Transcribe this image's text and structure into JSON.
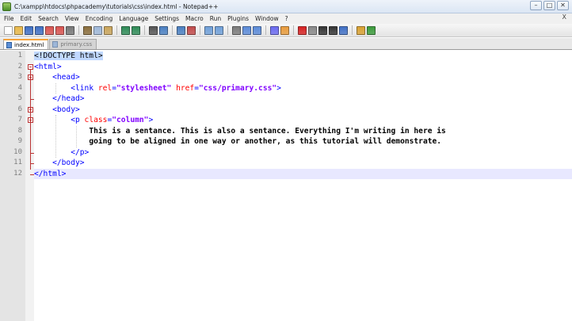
{
  "window": {
    "title": "C:\\xampp\\htdocs\\phpacademy\\tutorials\\css\\index.html - Notepad++",
    "controls": [
      "–",
      "□",
      "✕"
    ]
  },
  "menu": {
    "items": [
      "File",
      "Edit",
      "Search",
      "View",
      "Encoding",
      "Language",
      "Settings",
      "Macro",
      "Run",
      "Plugins",
      "Window",
      "?"
    ],
    "close": "X"
  },
  "tabs": [
    {
      "label": "index.html",
      "active": true
    },
    {
      "label": "primary.css",
      "active": false
    }
  ],
  "editor": {
    "line_numbers": [
      "1",
      "2",
      "3",
      "4",
      "5",
      "6",
      "7",
      "8",
      "9",
      "10",
      "11",
      "12"
    ],
    "current_line": 12,
    "lines": [
      [
        {
          "t": "doctype",
          "v": "<!DOCTYPE html>"
        }
      ],
      [
        {
          "t": "tag",
          "v": "<html>"
        }
      ],
      [
        {
          "t": "plain",
          "v": "    "
        },
        {
          "t": "tag",
          "v": "<head>"
        }
      ],
      [
        {
          "t": "plain",
          "v": "        "
        },
        {
          "t": "tag",
          "v": "<link "
        },
        {
          "t": "attr",
          "v": "rel"
        },
        {
          "t": "tag",
          "v": "="
        },
        {
          "t": "val",
          "v": "\"stylesheet\""
        },
        {
          "t": "plain",
          "v": " "
        },
        {
          "t": "attr",
          "v": "href"
        },
        {
          "t": "tag",
          "v": "="
        },
        {
          "t": "val",
          "v": "\"css/primary.css\""
        },
        {
          "t": "tag",
          "v": ">"
        }
      ],
      [
        {
          "t": "plain",
          "v": "    "
        },
        {
          "t": "tag",
          "v": "</head>"
        }
      ],
      [
        {
          "t": "plain",
          "v": "    "
        },
        {
          "t": "tag",
          "v": "<body>"
        }
      ],
      [
        {
          "t": "plain",
          "v": "        "
        },
        {
          "t": "tag",
          "v": "<p "
        },
        {
          "t": "attr",
          "v": "class"
        },
        {
          "t": "tag",
          "v": "="
        },
        {
          "t": "val",
          "v": "\"column\""
        },
        {
          "t": "tag",
          "v": ">"
        }
      ],
      [
        {
          "t": "plain",
          "v": "            "
        },
        {
          "t": "text",
          "v": "This is a sentance. This is also a sentance. Everything I'm writing in here is"
        }
      ],
      [
        {
          "t": "plain",
          "v": "            "
        },
        {
          "t": "text",
          "v": "going to be aligned in one way or another, as this tutorial will demonstrate."
        }
      ],
      [
        {
          "t": "plain",
          "v": "        "
        },
        {
          "t": "tag",
          "v": "</p>"
        }
      ],
      [
        {
          "t": "plain",
          "v": "    "
        },
        {
          "t": "tag",
          "v": "</body>"
        }
      ],
      [
        {
          "t": "tag",
          "v": "</html>"
        }
      ]
    ]
  },
  "toolbar": {
    "buttons": [
      "new-icon",
      "open-icon",
      "save-icon",
      "save-all-icon",
      "close-icon",
      "close-all-icon",
      "print-icon",
      "sep",
      "cut-icon",
      "copy-icon",
      "paste-icon",
      "sep",
      "undo-icon",
      "redo-icon",
      "sep",
      "find-icon",
      "replace-icon",
      "sep",
      "zoom-in-icon",
      "zoom-out-icon",
      "sep",
      "sync-v-icon",
      "sync-h-icon",
      "sep",
      "wrap-icon",
      "all-chars-icon",
      "indent-guide-icon",
      "sep",
      "udl-icon",
      "doc-map-icon",
      "sep",
      "record-icon",
      "stop-icon",
      "play-icon",
      "play-multi-icon",
      "save-macro-icon",
      "sep",
      "launch-icon",
      "spell-icon"
    ],
    "colors": {
      "new-icon": "#ffffff",
      "open-icon": "#e8b84a",
      "save-icon": "#3f6fc4",
      "save-all-icon": "#3f6fc4",
      "close-icon": "#d9534f",
      "close-all-icon": "#d9534f",
      "print-icon": "#777777",
      "cut-icon": "#8a6d3b",
      "copy-icon": "#9fb8d8",
      "paste-icon": "#c9a45a",
      "undo-icon": "#2e8b57",
      "redo-icon": "#2e8b57",
      "find-icon": "#555555",
      "replace-icon": "#4a7fc1",
      "zoom-in-icon": "#4a7fc1",
      "zoom-out-icon": "#c14a4a",
      "sync-v-icon": "#6f9fd8",
      "sync-h-icon": "#6f9fd8",
      "wrap-icon": "#7a7a7a",
      "all-chars-icon": "#5a8ad8",
      "indent-guide-icon": "#5a8ad8",
      "udl-icon": "#6a6af0",
      "doc-map-icon": "#e89a3a",
      "record-icon": "#d62020",
      "stop-icon": "#888888",
      "play-icon": "#333333",
      "play-multi-icon": "#333333",
      "save-macro-icon": "#3f6fc4",
      "launch-icon": "#d8a030",
      "spell-icon": "#3a9a3a"
    }
  }
}
